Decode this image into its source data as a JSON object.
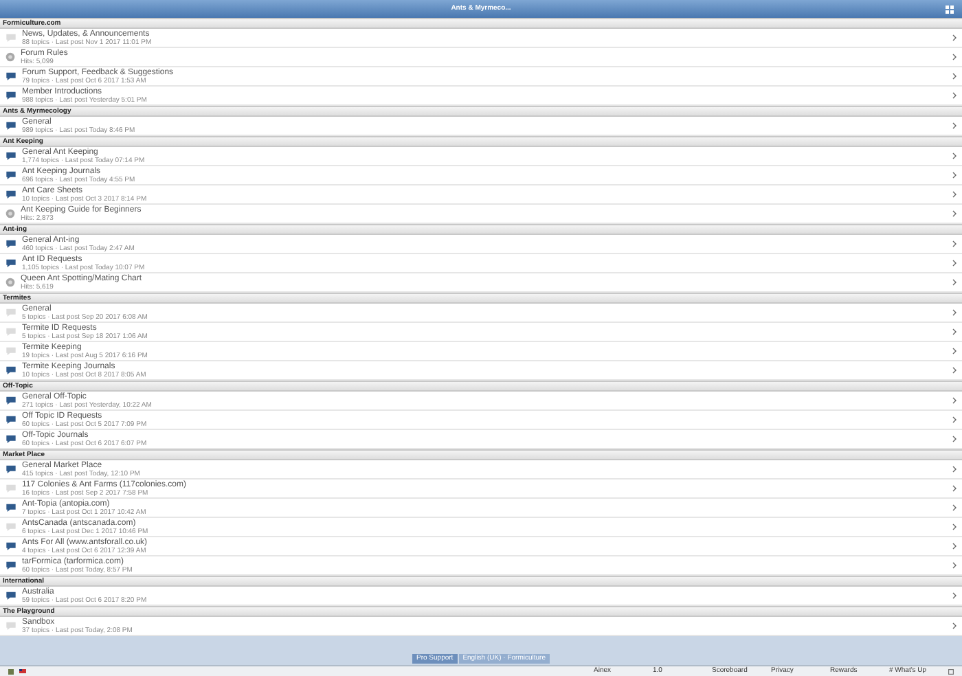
{
  "header": {
    "title": "Ants & Myrmeco..."
  },
  "categories": [
    {
      "name": "Formiculture.com",
      "forums": [
        {
          "kind": "read",
          "title": "News, Updates, & Announcements",
          "meta": "88 topics · Last post Nov 1 2017 11:01 PM"
        },
        {
          "kind": "link",
          "title": "Forum Rules",
          "meta": "Hits: 5,099"
        },
        {
          "kind": "new",
          "title": "Forum Support, Feedback & Suggestions",
          "meta": "79 topics · Last post Oct 6 2017 1:53 AM"
        },
        {
          "kind": "new",
          "title": "Member Introductions",
          "meta": "988 topics · Last post Yesterday 5:01 PM"
        }
      ]
    },
    {
      "name": "Ants & Myrmecology",
      "forums": [
        {
          "kind": "new",
          "title": "General",
          "meta": "989 topics · Last post Today 8:46 PM"
        }
      ]
    },
    {
      "name": "Ant Keeping",
      "forums": [
        {
          "kind": "new",
          "title": "General Ant Keeping",
          "meta": "1,774 topics · Last post Today 07:14 PM"
        },
        {
          "kind": "new",
          "title": "Ant Keeping Journals",
          "meta": "696 topics · Last post Today 4:55 PM"
        },
        {
          "kind": "new",
          "title": "Ant Care Sheets",
          "meta": "10 topics · Last post Oct 3 2017 8:14 PM"
        },
        {
          "kind": "link",
          "title": "Ant Keeping Guide for Beginners",
          "meta": "Hits: 2,873"
        }
      ]
    },
    {
      "name": "Ant-ing",
      "forums": [
        {
          "kind": "new",
          "title": "General Ant-ing",
          "meta": "460 topics · Last post Today 2:47 AM"
        },
        {
          "kind": "new",
          "title": "Ant ID Requests",
          "meta": "1,105 topics · Last post Today 10:07 PM"
        },
        {
          "kind": "link",
          "title": "Queen Ant Spotting/Mating Chart",
          "meta": "Hits: 5,619"
        }
      ]
    },
    {
      "name": "Termites",
      "forums": [
        {
          "kind": "read",
          "title": "General",
          "meta": "5 topics · Last post Sep 20 2017 6:08 AM"
        },
        {
          "kind": "read",
          "title": "Termite ID Requests",
          "meta": "5 topics · Last post Sep 18 2017 1:06 AM"
        },
        {
          "kind": "read",
          "title": "Termite Keeping",
          "meta": "19 topics · Last post Aug 5 2017 6:16 PM"
        },
        {
          "kind": "new",
          "title": "Termite Keeping Journals",
          "meta": "10 topics · Last post Oct 8 2017 8:05 AM"
        }
      ]
    },
    {
      "name": "Off-Topic",
      "forums": [
        {
          "kind": "new",
          "title": "General Off-Topic",
          "meta": "271 topics · Last post Yesterday, 10:22 AM"
        },
        {
          "kind": "new",
          "title": "Off Topic ID Requests",
          "meta": "60 topics · Last post Oct 5 2017 7:09 PM"
        },
        {
          "kind": "new",
          "title": "Off-Topic Journals",
          "meta": "60 topics · Last post Oct 6 2017 6:07 PM"
        }
      ]
    },
    {
      "name": "Market Place",
      "forums": [
        {
          "kind": "new",
          "title": "General Market Place",
          "meta": "415 topics · Last post Today, 12:10 PM"
        },
        {
          "kind": "read",
          "title": "117 Colonies & Ant Farms (117colonies.com)",
          "meta": "16 topics · Last post Sep 2 2017 7:58 PM"
        },
        {
          "kind": "new",
          "title": "Ant-Topia (antopia.com)",
          "meta": "7 topics · Last post Oct 1 2017 10:42 AM"
        },
        {
          "kind": "read",
          "title": "AntsCanada (antscanada.com)",
          "meta": "6 topics · Last post Dec 1 2017 10:46 PM"
        },
        {
          "kind": "new",
          "title": "Ants For All (www.antsforall.co.uk)",
          "meta": "4 topics · Last post Oct 6 2017 12:39 AM"
        },
        {
          "kind": "new",
          "title": "tarFormica (tarformica.com)",
          "meta": "60 topics · Last post Today, 8:57 PM"
        }
      ]
    },
    {
      "name": "International",
      "forums": [
        {
          "kind": "new",
          "title": "Australia",
          "meta": "59 topics · Last post Oct 6 2017 8:20 PM"
        }
      ]
    },
    {
      "name": "The Playground",
      "forums": [
        {
          "kind": "read",
          "title": "Sandbox",
          "meta": "37 topics · Last post Today, 2:08 PM"
        }
      ]
    }
  ],
  "footer_tabs": [
    {
      "label": "Pro Support",
      "selected": true
    },
    {
      "label": "English (UK) · Formiculture",
      "selected": false
    }
  ],
  "status_bar": [
    "Ainex",
    "1.0",
    "Scoreboard",
    "Privacy",
    "Rewards",
    "# What's Up"
  ]
}
